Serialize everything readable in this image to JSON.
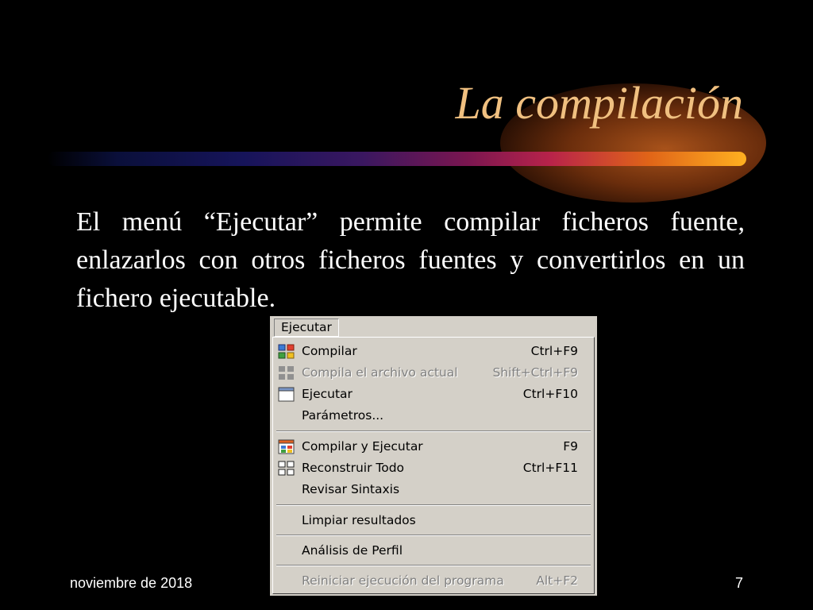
{
  "slide": {
    "title": "La compilación",
    "body": "El menú “Ejecutar”  permite  compilar ficheros fuente, enlazarlos con otros ficheros fuentes y convertirlos en un fichero ejecutable.",
    "footer_date": "noviembre de 2018",
    "page_number": "7",
    "colors": {
      "background": "#000000",
      "title": "#f0c080",
      "text": "#ffffff",
      "menu_bg": "#d4d0c8",
      "disabled": "#808080"
    }
  },
  "menu": {
    "title": "Ejecutar",
    "items": [
      {
        "label": "Compilar",
        "shortcut": "Ctrl+F9",
        "icon": "compile-grid-icon",
        "enabled": true
      },
      {
        "label": "Compila el archivo actual",
        "shortcut": "Shift+Ctrl+F9",
        "icon": "compile-file-icon",
        "enabled": false
      },
      {
        "label": "Ejecutar",
        "shortcut": "Ctrl+F10",
        "icon": "window-run-icon",
        "enabled": true
      },
      {
        "label": "Parámetros...",
        "shortcut": "",
        "icon": "",
        "enabled": true
      },
      {
        "label": "Compilar y Ejecutar",
        "shortcut": "F9",
        "icon": "compile-run-icon",
        "enabled": true
      },
      {
        "label": "Reconstruir Todo",
        "shortcut": "Ctrl+F11",
        "icon": "rebuild-grid-icon",
        "enabled": true
      },
      {
        "label": "Revisar Sintaxis",
        "shortcut": "",
        "icon": "",
        "enabled": true
      },
      {
        "label": "Limpiar resultados",
        "shortcut": "",
        "icon": "",
        "enabled": true
      },
      {
        "label": "Análisis de Perfil",
        "shortcut": "",
        "icon": "",
        "enabled": true
      },
      {
        "label": "Reiniciar ejecución del programa",
        "shortcut": "Alt+F2",
        "icon": "",
        "enabled": false
      }
    ]
  }
}
